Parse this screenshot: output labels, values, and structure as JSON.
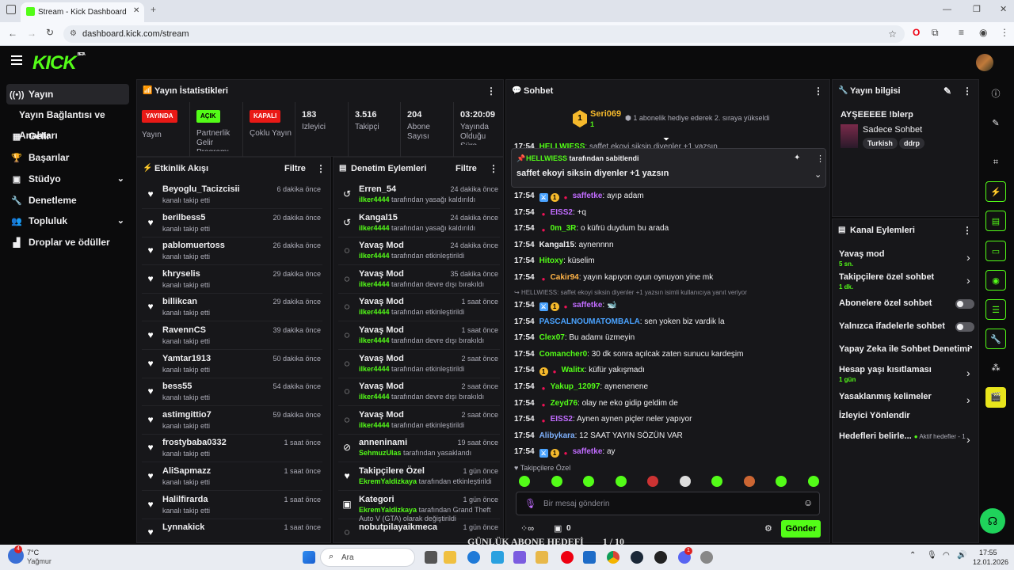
{
  "browser": {
    "tab_title": "Stream - Kick Dashboard",
    "url": "dashboard.kick.com/stream",
    "new_tab": "+"
  },
  "app": {
    "logo": "KICK",
    "logo_tag": "BETA"
  },
  "sidebar": {
    "items": [
      {
        "label": "Yayın",
        "icon": "broadcast-icon"
      },
      {
        "label": "Yayın Bağlantısı ve Anahtarı",
        "icon": ""
      },
      {
        "label": "Gelir",
        "icon": "money-icon"
      },
      {
        "label": "Başarılar",
        "icon": "trophy-icon"
      },
      {
        "label": "Stüdyo",
        "icon": "studio-icon"
      },
      {
        "label": "Denetleme",
        "icon": "wrench-icon"
      },
      {
        "label": "Topluluk",
        "icon": "community-icon"
      },
      {
        "label": "Droplar ve ödüller",
        "icon": "drops-icon"
      }
    ]
  },
  "stats": {
    "title": "Yayın İstatistikleri",
    "items": [
      {
        "badge": "YAYINDA",
        "label": "Yayın"
      },
      {
        "badge": "AÇIK",
        "label": "Partnerlik Gelir Programı"
      },
      {
        "badge": "KAPALI",
        "label": "Çoklu Yayın"
      },
      {
        "value": "183",
        "label": "İzleyici"
      },
      {
        "value": "3.516",
        "label": "Takipçi"
      },
      {
        "value": "204",
        "label": "Abone Sayısı"
      },
      {
        "value": "03:20:09",
        "label": "Yayında Olduğu Süre"
      }
    ]
  },
  "activity": {
    "title": "Etkinlik Akışı",
    "filter": "Filtre",
    "items": [
      {
        "name": "Beyoglu_Tacizcisii",
        "sub": "kanalı takip etti",
        "time": "6 dakika önce"
      },
      {
        "name": "berilbess5",
        "sub": "kanalı takip etti",
        "time": "20 dakika önce"
      },
      {
        "name": "pablomuertoss",
        "sub": "kanalı takip etti",
        "time": "26 dakika önce"
      },
      {
        "name": "khryselis",
        "sub": "kanalı takip etti",
        "time": "29 dakika önce"
      },
      {
        "name": "billikcan",
        "sub": "kanalı takip etti",
        "time": "29 dakika önce"
      },
      {
        "name": "RavennCS",
        "sub": "kanalı takip etti",
        "time": "39 dakika önce"
      },
      {
        "name": "Yamtar1913",
        "sub": "kanalı takip etti",
        "time": "50 dakika önce"
      },
      {
        "name": "bess55",
        "sub": "kanalı takip etti",
        "time": "54 dakika önce"
      },
      {
        "name": "astimgittio7",
        "sub": "kanalı takip etti",
        "time": "59 dakika önce"
      },
      {
        "name": "frostybaba0332",
        "sub": "kanalı takip etti",
        "time": "1 saat önce"
      },
      {
        "name": "AliSapmazz",
        "sub": "kanalı takip etti",
        "time": "1 saat önce"
      },
      {
        "name": "Halilfirarda",
        "sub": "kanalı takip etti",
        "time": "1 saat önce"
      },
      {
        "name": "Lynnakick",
        "sub": "",
        "time": "1 saat önce"
      }
    ]
  },
  "moderation": {
    "title": "Denetim Eylemleri",
    "filter": "Filtre",
    "items": [
      {
        "name": "Erren_54",
        "actor": "ilker4444",
        "rest": " tarafından yasağı kaldırıldı",
        "time": "24 dakika önce",
        "icon": "undo-icon"
      },
      {
        "name": "Kangal15",
        "actor": "ilker4444",
        "rest": " tarafından yasağı kaldırıldı",
        "time": "24 dakika önce",
        "icon": "undo-icon"
      },
      {
        "name": "Yavaş Mod",
        "actor": "ilker4444",
        "rest": " tarafından etkinleştirildi",
        "time": "24 dakika önce",
        "icon": "snail-icon"
      },
      {
        "name": "Yavaş Mod",
        "actor": "ilker4444",
        "rest": " tarafından devre dışı bırakıldı",
        "time": "35 dakika önce",
        "icon": "snail-icon"
      },
      {
        "name": "Yavaş Mod",
        "actor": "ilker4444",
        "rest": " tarafından etkinleştirildi",
        "time": "1 saat önce",
        "icon": "snail-icon"
      },
      {
        "name": "Yavaş Mod",
        "actor": "ilker4444",
        "rest": " tarafından devre dışı bırakıldı",
        "time": "1 saat önce",
        "icon": "snail-icon"
      },
      {
        "name": "Yavaş Mod",
        "actor": "ilker4444",
        "rest": " tarafından etkinleştirildi",
        "time": "2 saat önce",
        "icon": "snail-icon"
      },
      {
        "name": "Yavaş Mod",
        "actor": "ilker4444",
        "rest": " tarafından devre dışı bırakıldı",
        "time": "2 saat önce",
        "icon": "snail-icon"
      },
      {
        "name": "Yavaş Mod",
        "actor": "ilker4444",
        "rest": " tarafından etkinleştirildi",
        "time": "2 saat önce",
        "icon": "snail-icon"
      },
      {
        "name": "anneninami",
        "actor": "SehmuzUlas",
        "rest": " tarafından yasaklandı",
        "time": "19 saat önce",
        "icon": "ban-icon"
      },
      {
        "name": "Takipçilere Özel",
        "actor": "EkremYaldizkaya",
        "rest": " tarafından etkinleştirildi",
        "time": "1 gün önce",
        "icon": "heart-icon"
      },
      {
        "name": "Kategori",
        "actor": "EkremYaldizkaya",
        "rest": " tarafından Grand Theft Auto V (GTA) olarak değiştirildi",
        "time": "1 gün önce",
        "icon": "category-icon"
      },
      {
        "name": "nobutpilayaikmeca",
        "actor": "",
        "rest": "",
        "time": "1 gün önce",
        "icon": "snail-icon"
      }
    ]
  },
  "chat": {
    "title": "Sohbet",
    "top_user": "Seri069",
    "top_count": "1",
    "gift_text": "1 abonelik hediye ederek 2. sıraya yükseldi",
    "pinned_by": "HELLWIESS",
    "pinned_suffix": "tarafından sabitlendi",
    "pinned_text": "saffet ekoyi siksin diyenler +1 yazsın",
    "reply_hint": "HELLWIESS: saffet ekoyi siksin diyenler +1 yazsın isimli kullanıcıya yanıt veriyor",
    "messages": [
      {
        "t": "17:54",
        "u": "HELLWIESS",
        "c": "#53fc18",
        "m": "saffet ekoyi siksin diyenler +1 yazsın"
      },
      {
        "t": "17:54",
        "u": "saffetke",
        "c": "#c16cff",
        "m": "ayıp adam"
      },
      {
        "t": "17:54",
        "u": "EISS2",
        "c": "#c16cff",
        "m": "+q"
      },
      {
        "t": "17:54",
        "u": "0m_3R",
        "c": "#53fc18",
        "m": "o küfrü duydum bu arada"
      },
      {
        "t": "17:54",
        "u": "Kangal15",
        "c": "#efeff1",
        "m": "aynennnn"
      },
      {
        "t": "17:54",
        "u": "Hitoxy",
        "c": "#53fc18",
        "m": "küselim"
      },
      {
        "t": "17:54",
        "u": "Cakir94",
        "c": "#ffb347",
        "m": "yayın kapıyon oyun oynuyon yine mk"
      },
      {
        "t": "17:54",
        "u": "saffetke",
        "c": "#c16cff",
        "m": "🐋"
      },
      {
        "t": "17:54",
        "u": "PASCALNOUMATOMBALA",
        "c": "#4aa3ff",
        "m": "sen yoken biz vardik la"
      },
      {
        "t": "17:54",
        "u": "Clex07",
        "c": "#53fc18",
        "m": "Bu adamı üzmeyin"
      },
      {
        "t": "17:54",
        "u": "Comancher0",
        "c": "#53fc18",
        "m": "30 dk sonra açılcak zaten sunucu kardeşim"
      },
      {
        "t": "17:54",
        "u": "Walitx",
        "c": "#53fc18",
        "m": "küfür yakışmadı"
      },
      {
        "t": "17:54",
        "u": "Yakup_12097",
        "c": "#53fc18",
        "m": "aynenenene"
      },
      {
        "t": "17:54",
        "u": "Zeyd76",
        "c": "#53fc18",
        "m": "olay ne eko gidip geldim de"
      },
      {
        "t": "17:54",
        "u": "EISS2",
        "c": "#c16cff",
        "m": "Aynen aynen piçler neler yapıyor"
      },
      {
        "t": "17:54",
        "u": "Alibykara",
        "c": "#7fb2ff",
        "m": "12 SAAT YAYIN SÖZÜN VAR"
      },
      {
        "t": "17:54",
        "u": "saffetke",
        "c": "#c16cff",
        "m": "ay"
      }
    ],
    "followers_only": "Takipçilere Özel",
    "input_placeholder": "Bir mesaj gönderin",
    "send": "Gönder",
    "points": "0",
    "overlay_text": "GÜNLÜK ABONE HEDEFİ",
    "overlay_progress": "1 / 10"
  },
  "streaminfo": {
    "title": "Yayın bilgisi",
    "stream_title": "AYŞEEEEE !blerp",
    "category": "Sadece Sohbet",
    "tags": [
      "Turkish",
      "ddrp"
    ]
  },
  "channel": {
    "title": "Kanal Eylemleri",
    "actions": [
      {
        "label": "Yavaş mod",
        "sub": "5 sn.",
        "type": "arrow"
      },
      {
        "label": "Takipçilere özel sohbet",
        "sub": "1 dk.",
        "type": "arrow"
      },
      {
        "label": "Abonelere özel sohbet",
        "sub": "",
        "type": "toggle"
      },
      {
        "label": "Yalnızca ifadelerle sohbet",
        "sub": "",
        "type": "toggle"
      },
      {
        "label": "Yapay Zeka ile Sohbet Denetimi",
        "sub": "",
        "type": "external"
      },
      {
        "label": "Hesap yaşı kısıtlaması",
        "sub": "1 gün",
        "type": "arrow"
      },
      {
        "label": "Yasaklanmış kelimeler",
        "sub": "",
        "type": "arrow"
      },
      {
        "label": "İzleyici Yönlendir",
        "sub": "",
        "type": "none"
      },
      {
        "label": "Hedefleri belirle...",
        "sub": "Aktif hedefler - 1",
        "type": "arrow"
      }
    ]
  },
  "taskbar": {
    "weather_temp": "7°C",
    "weather_desc": "Yağmur",
    "weather_badge": "4",
    "search": "Ara",
    "time": "17:55",
    "date": "12.01.2026",
    "discord_badge": "1"
  },
  "colors": {
    "accent": "#53fc18",
    "live": "#e91916",
    "panel": "#17171a"
  }
}
